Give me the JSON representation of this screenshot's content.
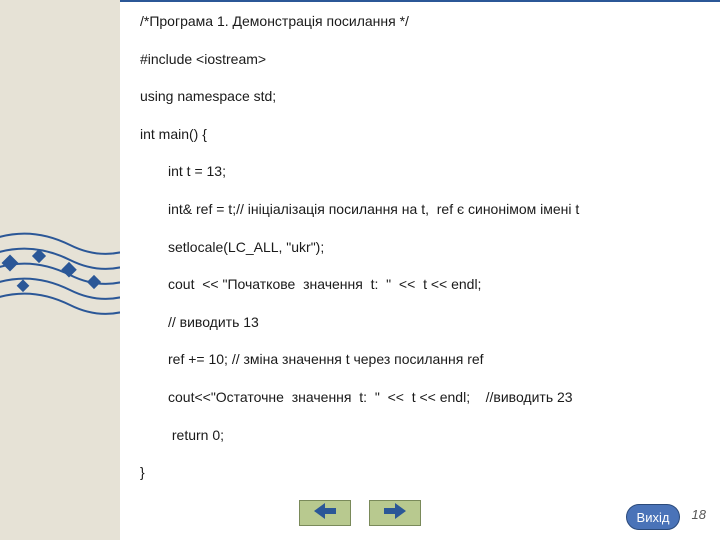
{
  "code": {
    "l1": "/*Програма 1. Демонстрація посилання */",
    "l2": "#include <iostream>",
    "l3": "using namespace std;",
    "l4": "int main() {",
    "l5": "int t = 13;",
    "l6": "int& ref = t;// ініціалізація посилання на t,  ref є синонімом імені t",
    "l7": "setlocale(LC_ALL, \"ukr\");",
    "l8": "cout  << \"Початкове  значення  t:  \"  <<  t << endl;",
    "l9": "// виводить 13",
    "l10": "ref += 10; // зміна значення t через посилання ref",
    "l11": "cout<<\"Остаточне  значення  t:  \"  <<  t << endl;    //виводить 23",
    "l12": " return 0;",
    "l13": "}"
  },
  "page_number": "18",
  "nav": {
    "exit_label": "Вихід"
  }
}
